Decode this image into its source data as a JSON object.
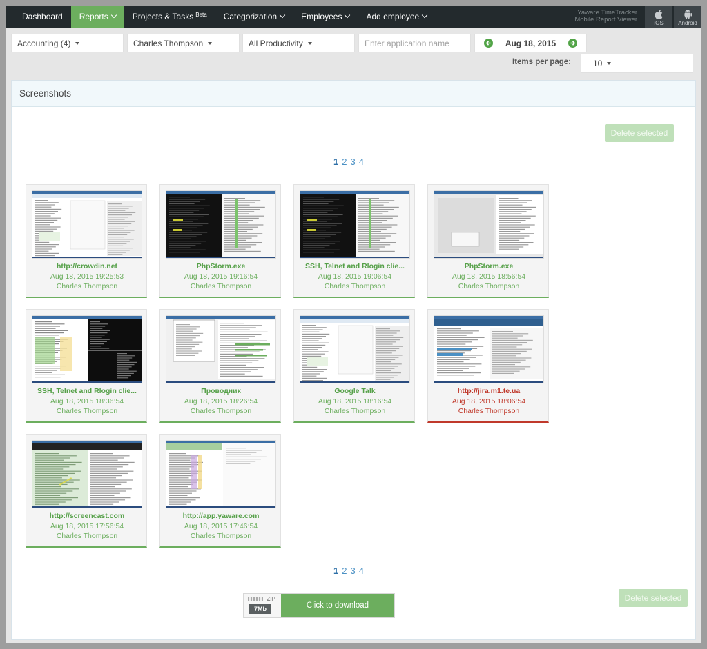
{
  "nav": {
    "items": [
      {
        "label": "Dashboard",
        "caret": false,
        "active": false
      },
      {
        "label": "Reports",
        "caret": true,
        "active": true
      },
      {
        "label": "Projects & Tasks",
        "sup": "Beta",
        "caret": false,
        "active": false
      },
      {
        "label": "Categorization",
        "caret": true,
        "active": false
      },
      {
        "label": "Employees",
        "caret": true,
        "active": false
      },
      {
        "label": "Add employee",
        "caret": true,
        "active": false
      }
    ],
    "mobile_line1": "Yaware.TimeTracker",
    "mobile_line2": "Mobile Report Viewer",
    "ios_label": "iOS",
    "android_label": "Android"
  },
  "filters": {
    "department": "Accounting (4)",
    "employee": "Charles Thompson",
    "productivity": "All Productivity",
    "app_placeholder": "Enter application name",
    "date": "Aug 18, 2015"
  },
  "items_per_page": {
    "label": "Items per page:",
    "value": "10"
  },
  "panel": {
    "title": "Screenshots",
    "delete_label": "Delete selected",
    "pages": [
      "1",
      "2",
      "3",
      "4"
    ],
    "current_page": "1"
  },
  "screenshots": [
    {
      "title": "http://crowdin.net",
      "time": "Aug 18, 2015 19:25:53",
      "user": "Charles Thompson",
      "alert": false,
      "theme": "light"
    },
    {
      "title": "PhpStorm.exe",
      "time": "Aug 18, 2015 19:16:54",
      "user": "Charles Thompson",
      "alert": false,
      "theme": "dark"
    },
    {
      "title": "SSH, Telnet and Rlogin clie...",
      "time": "Aug 18, 2015 19:06:54",
      "user": "Charles Thompson",
      "alert": false,
      "theme": "dark"
    },
    {
      "title": "PhpStorm.exe",
      "time": "Aug 18, 2015 18:56:54",
      "user": "Charles Thompson",
      "alert": false,
      "theme": "gray"
    },
    {
      "title": "SSH, Telnet and Rlogin clie...",
      "time": "Aug 18, 2015 18:36:54",
      "user": "Charles Thompson",
      "alert": false,
      "theme": "split"
    },
    {
      "title": "Проводник",
      "time": "Aug 18, 2015 18:26:54",
      "user": "Charles Thompson",
      "alert": false,
      "theme": "explorer"
    },
    {
      "title": "Google Talk",
      "time": "Aug 18, 2015 18:16:54",
      "user": "Charles Thompson",
      "alert": false,
      "theme": "light"
    },
    {
      "title": "http://jira.m1.te.ua",
      "time": "Aug 18, 2015 18:06:54",
      "user": "Charles Thompson",
      "alert": true,
      "theme": "jira"
    },
    {
      "title": "http://screencast.com",
      "time": "Aug 18, 2015 17:56:54",
      "user": "Charles Thompson",
      "alert": false,
      "theme": "screencast"
    },
    {
      "title": "http://app.yaware.com",
      "time": "Aug 18, 2015 17:46:54",
      "user": "Charles Thompson",
      "alert": false,
      "theme": "app"
    }
  ],
  "download": {
    "zip_label": "ZIP",
    "size": "7Mb",
    "button": "Click to download"
  },
  "colors": {
    "accent": "#6cae5e",
    "alert": "#c0392b",
    "navbar": "#232a2d",
    "link": "#4a90c4"
  }
}
